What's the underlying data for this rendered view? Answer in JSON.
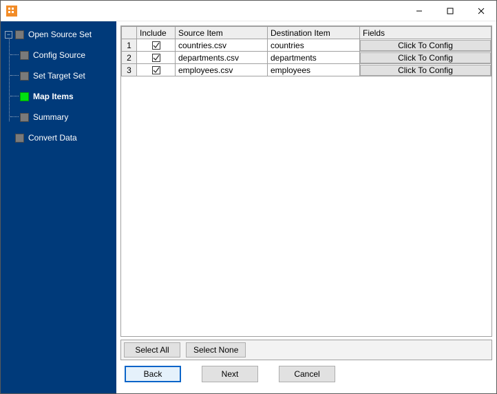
{
  "titlebar": {
    "title": ""
  },
  "sidebar": {
    "expander": "−",
    "root": "Open Source Set",
    "children": [
      {
        "label": "Config Source",
        "active": false
      },
      {
        "label": "Set Target Set",
        "active": false
      },
      {
        "label": "Map Items",
        "active": true
      },
      {
        "label": "Summary",
        "active": false
      }
    ],
    "root2": "Convert Data"
  },
  "grid": {
    "headers": {
      "include": "Include",
      "source": "Source Item",
      "dest": "Destination Item",
      "fields": "Fields"
    },
    "config_label": "Click To Config",
    "rows": [
      {
        "n": "1",
        "include": true,
        "source": "countries.csv",
        "dest": "countries"
      },
      {
        "n": "2",
        "include": true,
        "source": "departments.csv",
        "dest": "departments"
      },
      {
        "n": "3",
        "include": true,
        "source": "employees.csv",
        "dest": "employees"
      }
    ]
  },
  "selection": {
    "select_all": "Select All",
    "select_none": "Select None"
  },
  "footer": {
    "back": "Back",
    "next": "Next",
    "cancel": "Cancel"
  }
}
